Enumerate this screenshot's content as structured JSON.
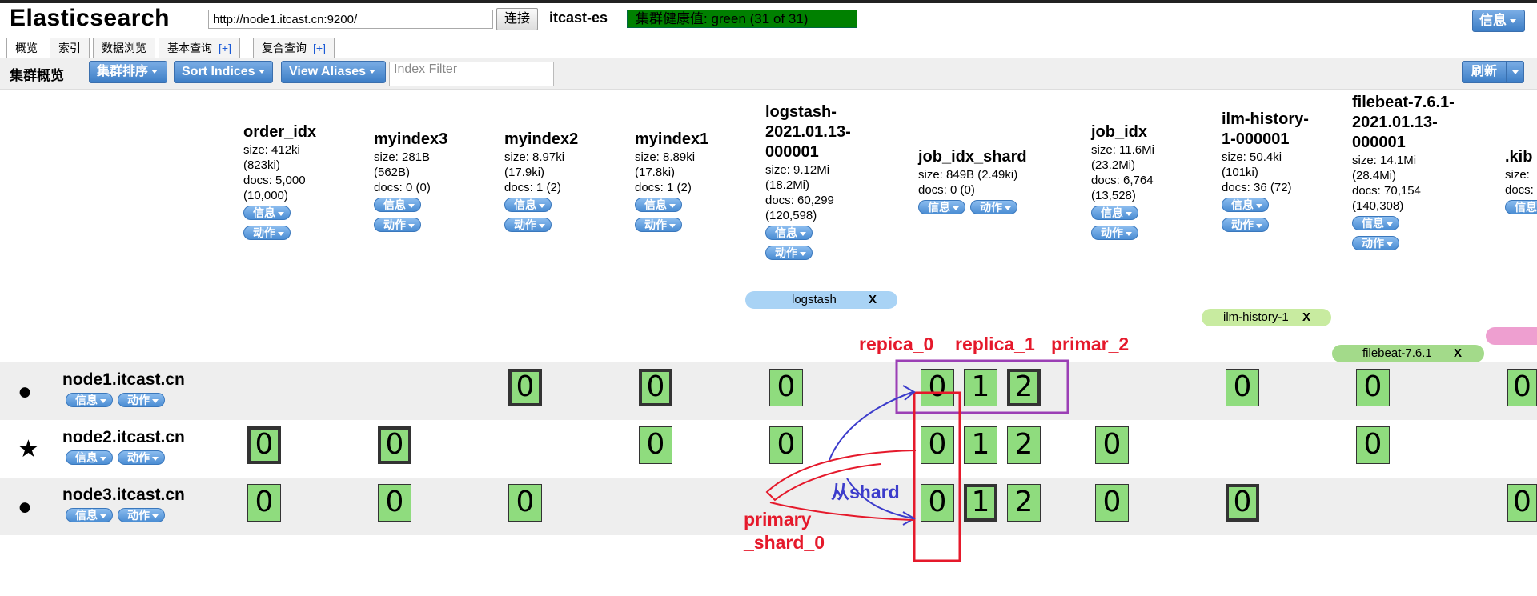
{
  "header": {
    "brand": "Elasticsearch",
    "url_value": "http://node1.itcast.cn:9200/",
    "connect_label": "连接",
    "cluster_name": "itcast-es",
    "health_text": "集群健康值: green (31 of 31)",
    "info_label": "信息"
  },
  "tabs": [
    {
      "label": "概览",
      "active": true
    },
    {
      "label": "索引"
    },
    {
      "label": "数据浏览"
    },
    {
      "label": "基本查询",
      "plus": "[+]"
    },
    {
      "label": "复合查询",
      "plus": "[+]"
    }
  ],
  "toolbar": {
    "title": "集群概览",
    "sort_cluster": "集群排序",
    "sort_indices": "Sort Indices",
    "view_aliases": "View Aliases",
    "filter_placeholder": "Index Filter",
    "refresh": "刷新"
  },
  "pill_labels": {
    "info": "信息",
    "action": "动作"
  },
  "indices": [
    {
      "name": "order_idx",
      "size": "size: 412ki",
      "size2": "(823ki)",
      "docs": "docs: 5,000",
      "docs2": "(10,000)"
    },
    {
      "name": "myindex3",
      "size": "size: 281B",
      "size2": "(562B)",
      "docs": "docs: 0 (0)"
    },
    {
      "name": "myindex2",
      "size": "size: 8.97ki",
      "size2": "(17.9ki)",
      "docs": "docs: 1 (2)"
    },
    {
      "name": "myindex1",
      "size": "size: 8.89ki",
      "size2": "(17.8ki)",
      "docs": "docs: 1 (2)"
    },
    {
      "name": "logstash-2021.01.13-000001",
      "size": "size: 9.12Mi",
      "size2": "(18.2Mi)",
      "docs": "docs: 60,299",
      "docs2": "(120,598)"
    },
    {
      "name": "job_idx_shard",
      "size": "size: 849B (2.49ki)",
      "docs": "docs: 0 (0)"
    },
    {
      "name": "job_idx",
      "size": "size: 11.6Mi",
      "size2": "(23.2Mi)",
      "docs": "docs: 6,764",
      "docs2": "(13,528)"
    },
    {
      "name": "ilm-history-1-000001",
      "size": "size: 50.4ki",
      "size2": "(101ki)",
      "docs": "docs: 36 (72)"
    },
    {
      "name": "filebeat-7.6.1-2021.01.13-000001",
      "size": "size: 14.1Mi",
      "size2": "(28.4Mi)",
      "docs": "docs: 70,154",
      "docs2": "(140,308)"
    },
    {
      "name": ".kib",
      "size": "size:",
      "docs": "docs:"
    }
  ],
  "aliases": [
    {
      "name": "logstash",
      "close": "X",
      "color": "#a9d3f5"
    },
    {
      "name": "ilm-history-1",
      "close": "X",
      "color": "#c8eba0"
    },
    {
      "name": "filebeat-7.6.1",
      "close": "X",
      "color": "#a3da8a"
    },
    {
      "name": "",
      "color": "#ee9fd0"
    }
  ],
  "nodes": [
    {
      "name": "node1.itcast.cn",
      "icon": "circle-icon",
      "glyph": "●"
    },
    {
      "name": "node2.itcast.cn",
      "icon": "star-icon",
      "glyph": "★"
    },
    {
      "name": "node3.itcast.cn",
      "icon": "circle-icon",
      "glyph": "●"
    }
  ],
  "shards": [
    {
      "node": 0,
      "index": 2,
      "label": "0",
      "primary": true
    },
    {
      "node": 0,
      "index": 3,
      "label": "0",
      "primary": true
    },
    {
      "node": 0,
      "index": 4,
      "label": "0",
      "primary": false
    },
    {
      "node": 0,
      "index": 5,
      "label": "0",
      "primary": false
    },
    {
      "node": 0,
      "index": 5,
      "label": "1",
      "primary": false
    },
    {
      "node": 0,
      "index": 5,
      "label": "2",
      "primary": true
    },
    {
      "node": 0,
      "index": 7,
      "label": "0",
      "primary": false
    },
    {
      "node": 0,
      "index": 8,
      "label": "0",
      "primary": false
    },
    {
      "node": 0,
      "index": 9,
      "label": "0",
      "primary": false
    },
    {
      "node": 1,
      "index": 0,
      "label": "0",
      "primary": true
    },
    {
      "node": 1,
      "index": 1,
      "label": "0",
      "primary": true
    },
    {
      "node": 1,
      "index": 3,
      "label": "0",
      "primary": false
    },
    {
      "node": 1,
      "index": 4,
      "label": "0",
      "primary": false
    },
    {
      "node": 1,
      "index": 5,
      "label": "0",
      "primary": false
    },
    {
      "node": 1,
      "index": 5,
      "label": "1",
      "primary": false
    },
    {
      "node": 1,
      "index": 5,
      "label": "2",
      "primary": false
    },
    {
      "node": 1,
      "index": 6,
      "label": "0",
      "primary": false
    },
    {
      "node": 1,
      "index": 8,
      "label": "0",
      "primary": false
    },
    {
      "node": 2,
      "index": 0,
      "label": "0",
      "primary": false
    },
    {
      "node": 2,
      "index": 1,
      "label": "0",
      "primary": false
    },
    {
      "node": 2,
      "index": 2,
      "label": "0",
      "primary": false
    },
    {
      "node": 2,
      "index": 5,
      "label": "0",
      "primary": false
    },
    {
      "node": 2,
      "index": 5,
      "label": "1",
      "primary": true
    },
    {
      "node": 2,
      "index": 5,
      "label": "2",
      "primary": false
    },
    {
      "node": 2,
      "index": 6,
      "label": "0",
      "primary": false
    },
    {
      "node": 2,
      "index": 7,
      "label": "0",
      "primary": true
    },
    {
      "node": 2,
      "index": 9,
      "label": "0",
      "primary": false
    }
  ],
  "annotations": {
    "repica_0": "repica_0",
    "replica_1": "replica_1",
    "primar_2": "primar_2",
    "from_shard": "从shard",
    "primary_line1": "primary",
    "primary_line2": "_shard_0",
    "red": "#e5192b",
    "blue": "#3c3ccb",
    "purple": "#9b3fb5"
  }
}
